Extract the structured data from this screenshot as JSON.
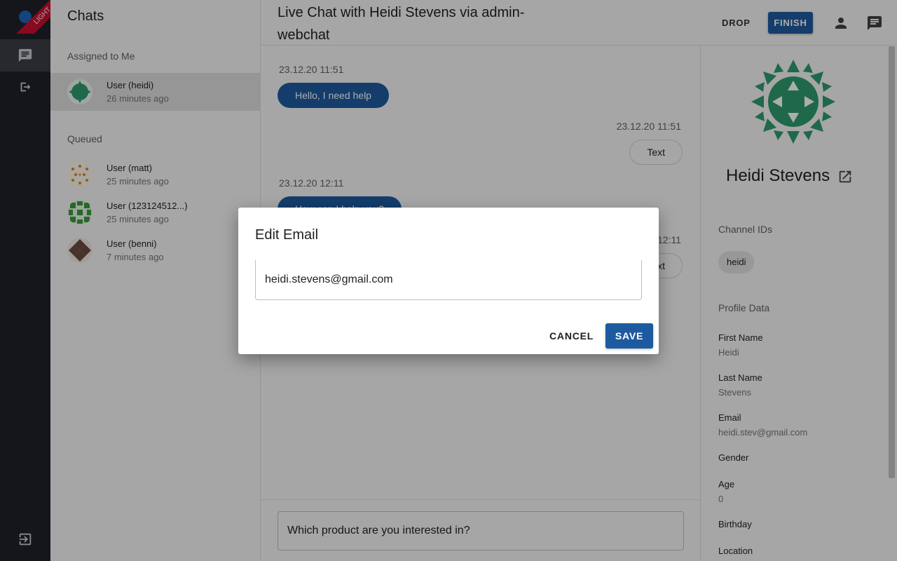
{
  "app": {
    "badge": "LIGHT",
    "colors": {
      "accent": "#1e5aa0",
      "rail": "#1e2129",
      "ribbon": "#c8102e"
    }
  },
  "rail": {
    "items": [
      {
        "icon": "chat-icon",
        "active": true
      },
      {
        "icon": "forward-icon",
        "active": false
      },
      {
        "icon": "logout-icon",
        "active": false
      }
    ]
  },
  "chatlist": {
    "title": "Chats",
    "assigned_label": "Assigned to Me",
    "queued_label": "Queued",
    "assigned": [
      {
        "name": "User (heidi)",
        "time": "26 minutes ago",
        "avatar_color": "#2e9b6e"
      }
    ],
    "queued": [
      {
        "name": "User (matt)",
        "time": "25 minutes ago",
        "avatar_color": "#d08a2a"
      },
      {
        "name": "User (123124512...)",
        "time": "25 minutes ago",
        "avatar_color": "#3a9a3a"
      },
      {
        "name": "User (benni)",
        "time": "7 minutes ago",
        "avatar_color": "#6b4a40"
      }
    ]
  },
  "header": {
    "title": "Live Chat with Heidi Stevens via admin-webchat",
    "drop_label": "DROP",
    "finish_label": "FINISH"
  },
  "messages": [
    {
      "timestamp": "23.12.20 11:51",
      "text": "Hello, I need help",
      "direction": "in"
    },
    {
      "timestamp": "23.12.20 11:51",
      "text": "Text",
      "direction": "out"
    },
    {
      "timestamp": "23.12.20 12:11",
      "text": "How can I help you?",
      "direction": "in"
    },
    {
      "timestamp": "23.12.20 12:11",
      "text": "Text",
      "direction": "out"
    }
  ],
  "composer": {
    "value": "Which product are you interested in?"
  },
  "profile": {
    "name": "Heidi Stevens",
    "channel_ids_label": "Channel IDs",
    "channel_id": "heidi",
    "profile_data_label": "Profile Data",
    "fields": [
      {
        "label": "First Name",
        "value": "Heidi"
      },
      {
        "label": "Last Name",
        "value": "Stevens"
      },
      {
        "label": "Email",
        "value": "heidi.stev@gmail.com"
      },
      {
        "label": "Gender",
        "value": ""
      },
      {
        "label": "Age",
        "value": "0"
      },
      {
        "label": "Birthday",
        "value": ""
      },
      {
        "label": "Location",
        "value": ""
      }
    ]
  },
  "dialog": {
    "title": "Edit Email",
    "email_value": "heidi.stevens@gmail.com",
    "cancel_label": "CANCEL",
    "save_label": "SAVE"
  }
}
